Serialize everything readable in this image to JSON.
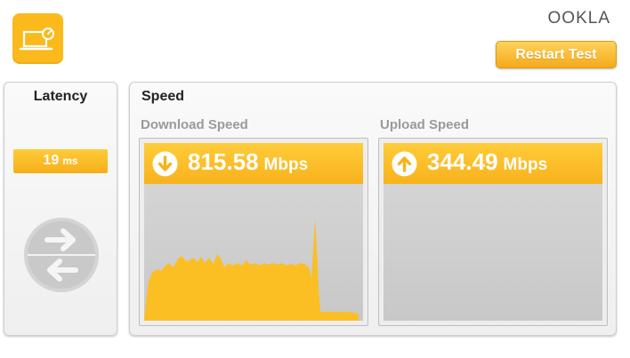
{
  "logo": {
    "text": "OOKLA"
  },
  "toolbar": {
    "restart_label": "Restart Test"
  },
  "latency": {
    "title": "Latency",
    "value": "19",
    "unit": "ms"
  },
  "speed": {
    "title": "Speed",
    "download": {
      "label": "Download Speed",
      "value": "815.58",
      "unit": "Mbps",
      "icon": "arrow-down-circle-icon"
    },
    "upload": {
      "label": "Upload Speed",
      "value": "344.49",
      "unit": "Mbps",
      "icon": "arrow-up-circle-icon"
    }
  },
  "colors": {
    "accent": "#fbb91c",
    "panel_bg": "#f4f4f4",
    "graph_bg": "#cfcfcf"
  }
}
